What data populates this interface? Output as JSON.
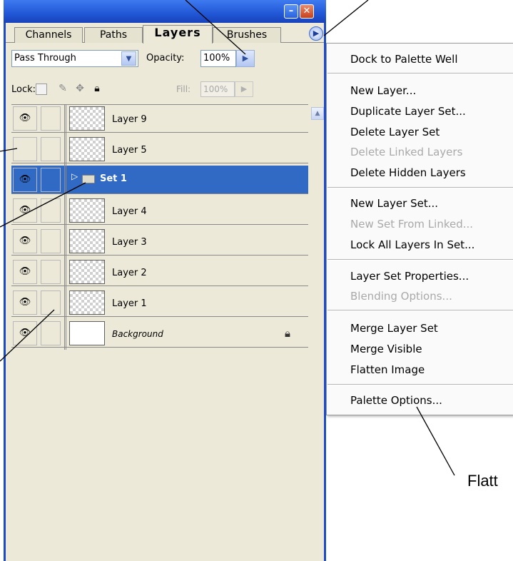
{
  "tabs": [
    "Channels",
    "Paths",
    "Layers",
    "Brushes"
  ],
  "active_tab": "Layers",
  "blend_mode": {
    "value": "Pass Through"
  },
  "opacity": {
    "label": "Opacity:",
    "value": "100%"
  },
  "lock": {
    "label": "Lock:"
  },
  "fill": {
    "label": "Fill:",
    "value": "100%"
  },
  "layers": [
    {
      "name": "Layer 9",
      "visible": true
    },
    {
      "name": "Layer 5",
      "visible": false
    },
    {
      "name": "Set 1",
      "visible": true,
      "type": "set",
      "selected": true
    },
    {
      "name": "Layer 4",
      "visible": true
    },
    {
      "name": "Layer 3",
      "visible": true
    },
    {
      "name": "Layer 2",
      "visible": true
    },
    {
      "name": "Layer 1",
      "visible": true
    },
    {
      "name": "Background",
      "visible": true,
      "locked": true
    }
  ],
  "menu": {
    "items": [
      {
        "label": "Dock to Palette Well",
        "enabled": true
      },
      {
        "label": "New Layer...",
        "enabled": true
      },
      {
        "label": "Duplicate Layer Set...",
        "enabled": true
      },
      {
        "label": "Delete Layer Set",
        "enabled": true
      },
      {
        "label": "Delete Linked Layers",
        "enabled": false
      },
      {
        "label": "Delete Hidden Layers",
        "enabled": true
      },
      {
        "label": "New Layer Set...",
        "enabled": true
      },
      {
        "label": "New Set From Linked...",
        "enabled": false
      },
      {
        "label": "Lock All Layers In Set...",
        "enabled": true
      },
      {
        "label": "Layer Set Properties...",
        "enabled": true
      },
      {
        "label": "Blending Options...",
        "enabled": false
      },
      {
        "label": "Merge Layer Set",
        "enabled": true
      },
      {
        "label": "Merge Visible",
        "enabled": true
      },
      {
        "label": "Flatten Image",
        "enabled": true
      },
      {
        "label": "Palette Options...",
        "enabled": true
      }
    ]
  },
  "callout": {
    "text": "Flatt"
  },
  "colors": {
    "selection": "#316ac5",
    "panel": "#ece9d8",
    "title_bar": "#2157d6"
  },
  "icons": [
    "eye-icon",
    "folder-icon",
    "lock-icon",
    "menu-arrow-icon",
    "close-icon",
    "minimize-icon"
  ]
}
